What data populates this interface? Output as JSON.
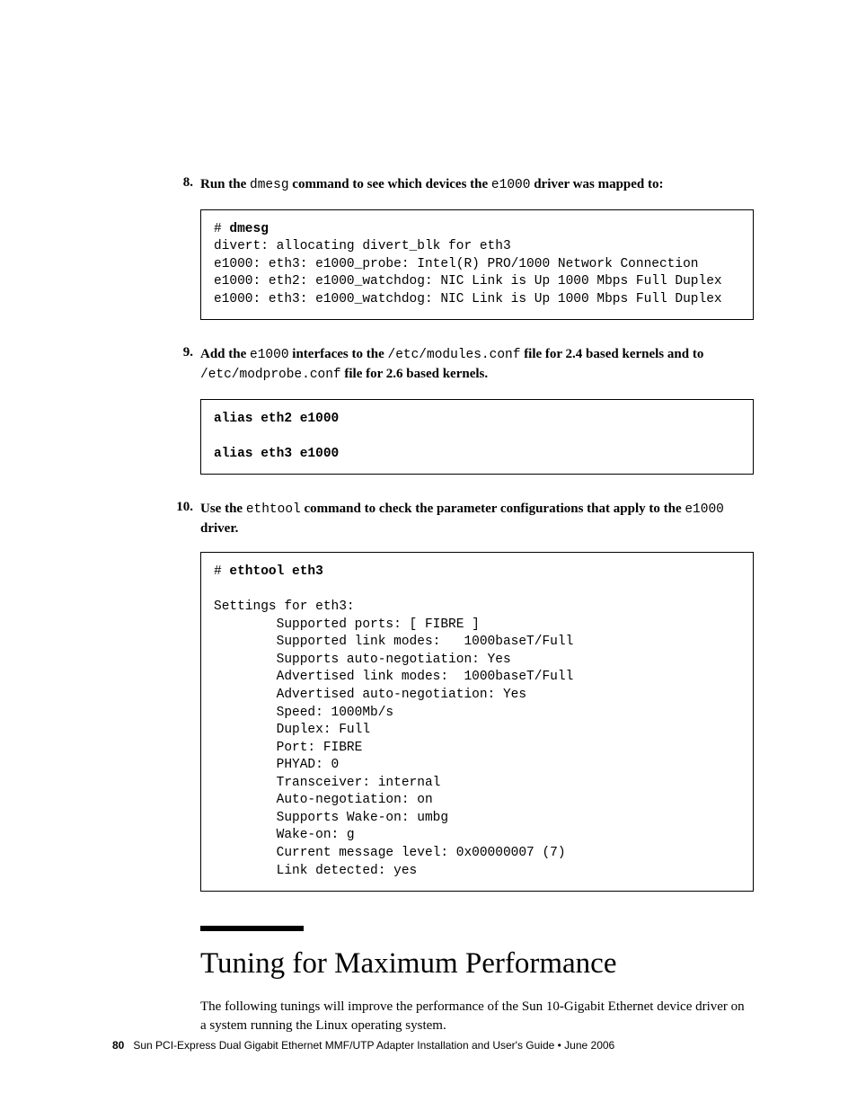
{
  "steps": {
    "s8": {
      "num": "8.",
      "pre1": "Run the ",
      "code1": "dmesg",
      "mid1": " command to see which devices the ",
      "code2": "e1000",
      "post1": " driver was mapped to:"
    },
    "s9": {
      "num": "9.",
      "pre1": "Add the ",
      "code1": "e1000",
      "mid1": " interfaces to the ",
      "code2": "/etc/modules.conf",
      "mid2": " file for 2.4 based kernels and to  ",
      "code3": "/etc/modprobe.conf",
      "post1": " file for 2.6 based kernels."
    },
    "s10": {
      "num": "10.",
      "pre1": "Use the ",
      "code1": "ethtool",
      "mid1": " command to check the parameter configurations that apply to the ",
      "code2": "e1000",
      "post1": " driver."
    }
  },
  "codeboxes": {
    "b8": {
      "prompt": "# ",
      "cmd": "dmesg",
      "out": "divert: allocating divert_blk for eth3\ne1000: eth3: e1000_probe: Intel(R) PRO/1000 Network Connection\ne1000: eth2: e1000_watchdog: NIC Link is Up 1000 Mbps Full Duplex\ne1000: eth3: e1000_watchdog: NIC Link is Up 1000 Mbps Full Duplex"
    },
    "b9": {
      "line1": "alias eth2 e1000",
      "line2": "alias eth3 e1000"
    },
    "b10": {
      "prompt": "# ",
      "cmd": "ethtool eth3",
      "out": "\nSettings for eth3:\n        Supported ports: [ FIBRE ]\n        Supported link modes:   1000baseT/Full\n        Supports auto-negotiation: Yes\n        Advertised link modes:  1000baseT/Full\n        Advertised auto-negotiation: Yes\n        Speed: 1000Mb/s\n        Duplex: Full\n        Port: FIBRE\n        PHYAD: 0\n        Transceiver: internal\n        Auto-negotiation: on\n        Supports Wake-on: umbg\n        Wake-on: g\n        Current message level: 0x00000007 (7)\n        Link detected: yes"
    }
  },
  "section": {
    "heading": "Tuning for Maximum Performance",
    "para": "The following tunings will improve the performance of the Sun 10-Gigabit Ethernet device driver on a system running the Linux operating system."
  },
  "footer": {
    "page": "80",
    "title": "Sun PCI-Express Dual Gigabit Ethernet MMF/UTP Adapter Installation and User's Guide  •  June 2006"
  }
}
